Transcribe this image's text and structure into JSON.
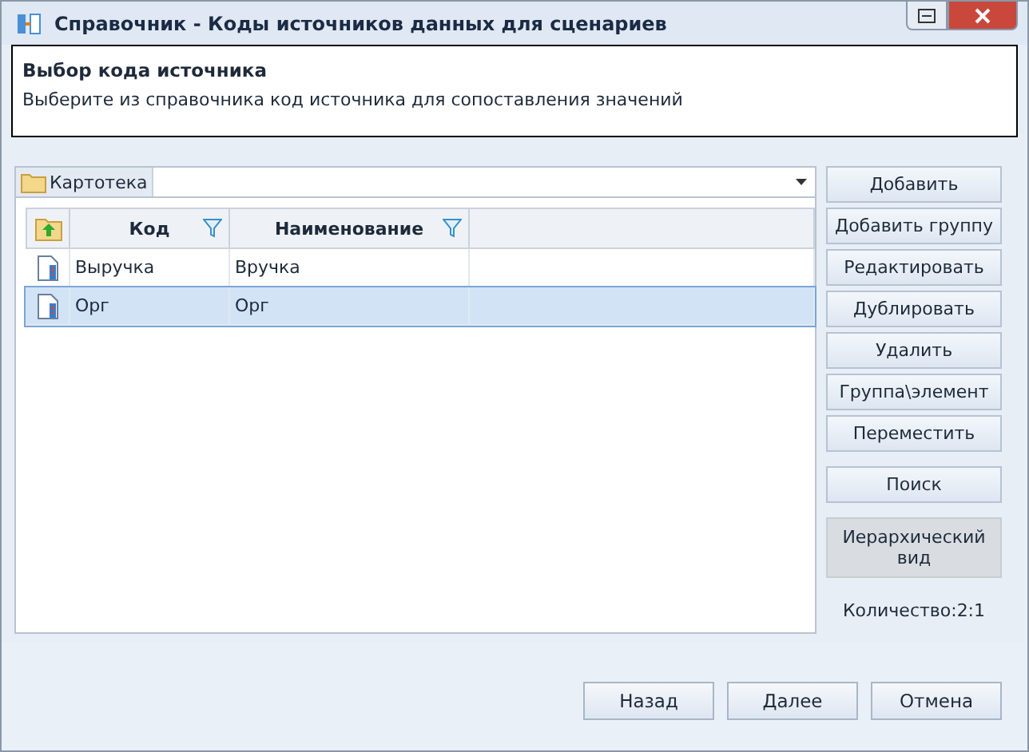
{
  "window": {
    "title": "Справочник - Коды источников данных для сценариев"
  },
  "header": {
    "title": "Выбор кода источника",
    "description": "Выберите из справочника код источника для сопоставления значений"
  },
  "breadcrumb": {
    "label": "Картотека"
  },
  "table": {
    "columns": [
      "Код",
      "Наименование"
    ],
    "rows": [
      {
        "code": "Выручка",
        "name": "Вручка",
        "selected": false
      },
      {
        "code": "Орг",
        "name": "Орг",
        "selected": true
      }
    ]
  },
  "action_groups": [
    [
      {
        "label": "Добавить",
        "pressed": false
      },
      {
        "label": "Добавить группу",
        "pressed": false
      },
      {
        "label": "Редактировать",
        "pressed": false
      },
      {
        "label": "Дублировать",
        "pressed": false
      },
      {
        "label": "Удалить",
        "pressed": false
      },
      {
        "label": "Группа\\элемент",
        "pressed": false
      },
      {
        "label": "Переместить",
        "pressed": false
      }
    ],
    [
      {
        "label": "Поиск",
        "pressed": false
      }
    ],
    [
      {
        "label": "Иерархический вид",
        "pressed": true
      }
    ]
  ],
  "count": "Количество:2:1",
  "buttons": [
    "Назад",
    "Далее",
    "Отмена"
  ]
}
